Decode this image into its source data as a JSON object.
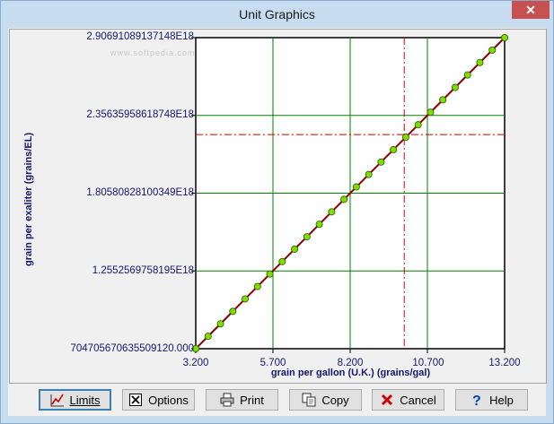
{
  "window": {
    "title": "Unit Graphics",
    "close_glyph": "✕"
  },
  "watermark": "www.softpedia.com",
  "chart_data": {
    "type": "line",
    "xlabel": "grain per gallon (U.K.) (grains/gal)",
    "ylabel": "grain per exaliter (grains/EL)",
    "x_ticks": [
      "3.200",
      "5.700",
      "8.200",
      "10.700",
      "13.200"
    ],
    "y_ticks": [
      "704705670635509120.000",
      "1.2552569758195E18",
      "1.80580828100349E18",
      "2.35635958618748E18",
      "2.90691089137148E18"
    ],
    "xlim": [
      3.2,
      13.2
    ],
    "ylim": [
      7.047056706355091e+17,
      2.90691089137148e+18
    ],
    "series": [
      {
        "x": [
          3.2,
          3.6,
          4.0,
          4.4,
          4.8,
          5.2,
          5.6,
          6.0,
          6.4,
          6.8,
          7.2,
          7.6,
          8.0,
          8.4,
          8.8,
          9.2,
          9.6,
          10.0,
          10.4,
          10.8,
          11.2,
          11.6,
          12.0,
          12.4,
          12.8,
          13.2
        ],
        "y": [
          7.047056706355091e+17,
          7.928e+17,
          8.809e+17,
          9.69e+17,
          1.0571e+18,
          1.1451e+18,
          1.2332e+18,
          1.3213e+18,
          1.4094e+18,
          1.4975e+18,
          1.5856e+18,
          1.6737e+18,
          1.7618e+18,
          1.8499e+18,
          1.938e+18,
          2.0261e+18,
          2.1142e+18,
          2.2023e+18,
          2.2904e+18,
          2.3785e+18,
          2.4666e+18,
          2.5546e+18,
          2.6427e+18,
          2.7308e+18,
          2.8189e+18,
          2.90691089137148e+18
        ]
      }
    ],
    "crosshair": {
      "x": 9.95,
      "y": 2.2205e+18
    },
    "colors": {
      "line": "#8b0000",
      "marker": "#7fdc00",
      "grid": "#008000",
      "crosshair": "#cc0000",
      "axis_text": "#16166e"
    }
  },
  "buttons": [
    {
      "id": "limits",
      "label": "Limits",
      "icon": "limits-icon"
    },
    {
      "id": "options",
      "label": "Options",
      "icon": "checkbox-x-icon"
    },
    {
      "id": "print",
      "label": "Print",
      "icon": "printer-icon"
    },
    {
      "id": "copy",
      "label": "Copy",
      "icon": "copy-icon"
    },
    {
      "id": "cancel",
      "label": "Cancel",
      "icon": "red-x-icon"
    },
    {
      "id": "help",
      "label": "Help",
      "icon": "question-icon"
    }
  ]
}
